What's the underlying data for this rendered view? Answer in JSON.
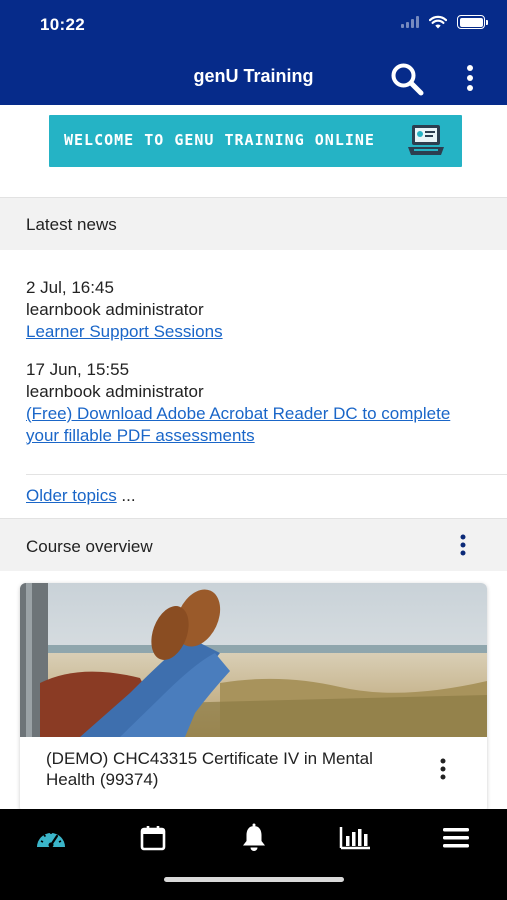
{
  "status_bar": {
    "time": "10:22"
  },
  "header": {
    "title": "genU Training"
  },
  "banner": {
    "text": "WELCOME TO GENU TRAINING ONLINE"
  },
  "latest_news": {
    "title": "Latest news",
    "items": [
      {
        "date": "2 Jul, 16:45",
        "author": "learnbook administrator",
        "link": "Learner Support Sessions"
      },
      {
        "date": "17 Jun, 15:55",
        "author": "learnbook administrator",
        "link": "(Free) Download Adobe Acrobat Reader DC to complete your fillable PDF assessments"
      }
    ],
    "older_link": "Older topics",
    "older_suffix": " ..."
  },
  "course_overview": {
    "title": "Course overview",
    "courses": [
      {
        "name": "(DEMO) CHC43315 Certificate IV in Mental Health (99374)"
      }
    ]
  },
  "bottom_nav": {
    "items": [
      {
        "icon": "dashboard-icon",
        "active": true
      },
      {
        "icon": "calendar-icon",
        "active": false
      },
      {
        "icon": "bell-icon",
        "active": false
      },
      {
        "icon": "grades-chart-icon",
        "active": false
      },
      {
        "icon": "menu-icon",
        "active": false
      }
    ]
  },
  "colors": {
    "header_bg": "#062b8a",
    "banner_bg": "#25b3c5",
    "link": "#1a66c8",
    "nav_active": "#3bb5c9",
    "nav_bg": "#000000"
  }
}
